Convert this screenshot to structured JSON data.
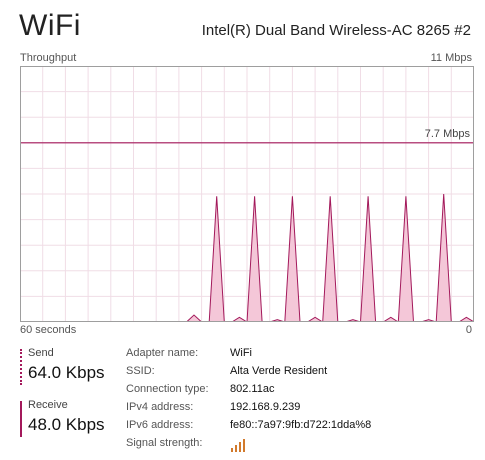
{
  "header": {
    "title": "WiFi",
    "adapter_name": "Intel(R) Dual Band Wireless-AC 8265 #2"
  },
  "graph": {
    "label_left": "Throughput",
    "label_max": "11 Mbps",
    "marker_label": "7.7 Mbps",
    "time_label": "60 seconds",
    "min_label": "0",
    "line_color": "#a3195b",
    "fill_color": "#f4c7d8",
    "grid_color": "#f0dde6"
  },
  "chart_data": {
    "type": "area",
    "y_unit": "Mbps",
    "ylim": [
      0,
      11
    ],
    "xlim": [
      60,
      0
    ],
    "marker_value": 7.7,
    "x": [
      60,
      59,
      58,
      57,
      56,
      55,
      54,
      53,
      52,
      51,
      50,
      49,
      48,
      47,
      46,
      45,
      44,
      43,
      42,
      41,
      40,
      39,
      38,
      37,
      36,
      35,
      34,
      33,
      32,
      31,
      30,
      29,
      28,
      27,
      26,
      25,
      24,
      23,
      22,
      21,
      20,
      19,
      18,
      17,
      16,
      15,
      14,
      13,
      12,
      11,
      10,
      9,
      8,
      7,
      6,
      5,
      4,
      3,
      2,
      1,
      0
    ],
    "series": [
      {
        "values": [
          0,
          0,
          0,
          0,
          0,
          0,
          0,
          0,
          0,
          0,
          0,
          0,
          0,
          0,
          0,
          0,
          0,
          0,
          0,
          0,
          0,
          0,
          0,
          0.3,
          0,
          0,
          5.4,
          0,
          0,
          0.2,
          0,
          5.4,
          0,
          0,
          0.1,
          0,
          5.4,
          0,
          0,
          0.2,
          0,
          5.4,
          0,
          0,
          0.1,
          0,
          5.4,
          0,
          0,
          0.2,
          0,
          5.4,
          0,
          0,
          0.1,
          0,
          5.5,
          0,
          0,
          0.2,
          0
        ]
      }
    ]
  },
  "stats": {
    "send_label": "Send",
    "send_value": "64.0 Kbps",
    "receive_label": "Receive",
    "receive_value": "48.0 Kbps"
  },
  "details": [
    {
      "key": "Adapter name:",
      "value": "WiFi"
    },
    {
      "key": "SSID:",
      "value": "Alta Verde Resident"
    },
    {
      "key": "Connection type:",
      "value": "802.11ac"
    },
    {
      "key": "IPv4 address:",
      "value": "192.168.9.239"
    },
    {
      "key": "IPv6 address:",
      "value": "fe80::7a97:9fb:d722:1dda%8"
    },
    {
      "key": "Signal strength:",
      "icon": "signal-strength-icon",
      "bars": 4
    }
  ]
}
